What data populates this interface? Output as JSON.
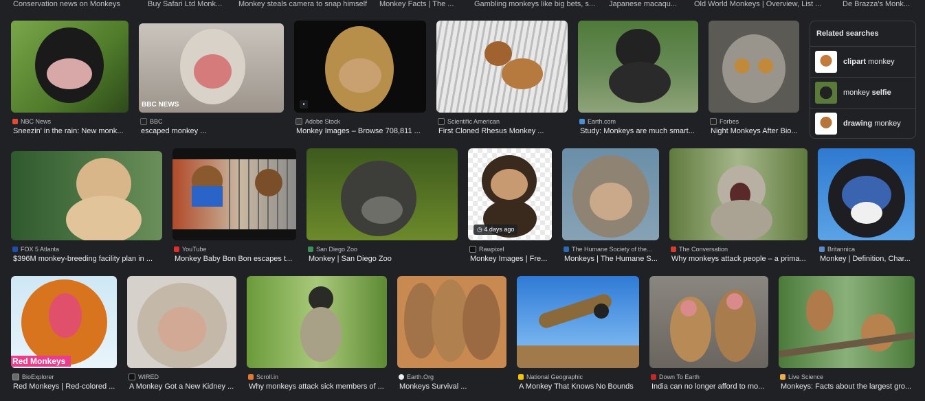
{
  "top_captions": [
    "Conservation news on Monkeys",
    "Buy Safari Ltd Monk...",
    "Monkey steals camera to snap himself",
    "Monkey Facts | The ...",
    "Gambling monkeys like big bets, s...",
    "Japanese macaqu...",
    "Old World Monkeys | Overview, List ...",
    "De Brazza's Monk..."
  ],
  "row1": [
    {
      "source": "NBC News",
      "caption": "Sneezin' in the rain: New monk...",
      "fav": "#e14b32"
    },
    {
      "source": "BBC",
      "caption": "escaped monkey ...",
      "fav": "#222222",
      "overlay": "BBC NEWS"
    },
    {
      "source": "Adobe Stock",
      "caption": "Monkey Images – Browse 708,811 ...",
      "fav": "#3a3a3a"
    },
    {
      "source": "Scientific American",
      "caption": "First Cloned Rhesus Monkey ...",
      "fav": "#1a1a1a"
    },
    {
      "source": "Earth.com",
      "caption": "Study: Monkeys are much smart...",
      "fav": "#4a90d9"
    },
    {
      "source": "Forbes",
      "caption": "Night Monkeys After Bio...",
      "fav": "#222222"
    }
  ],
  "related": {
    "title": "Related searches",
    "items": [
      {
        "bold": "clipart",
        "rest": " monkey",
        "bold_first": true
      },
      {
        "bold": "selfie",
        "rest": "monkey ",
        "bold_first": false
      },
      {
        "bold": "drawing",
        "rest": " monkey",
        "bold_first": true
      }
    ]
  },
  "row2": [
    {
      "source": "FOX 5 Atlanta",
      "caption": "$396M monkey-breeding facility plan in ...",
      "fav": "#1f4fa8"
    },
    {
      "source": "YouTube",
      "caption": "Monkey Baby Bon Bon escapes t...",
      "fav": "#e52d27"
    },
    {
      "source": "San Diego Zoo",
      "caption": "Monkey | San Diego Zoo",
      "fav": "#3e8e5a"
    },
    {
      "source": "Rawpixel",
      "caption": "Monkey Images | Fre...",
      "fav": "#111111",
      "badge": "4 days ago"
    },
    {
      "source": "The Humane Society of the...",
      "caption": "Monkeys | The Humane S...",
      "fav": "#2b6cb0"
    },
    {
      "source": "The Conversation",
      "caption": "Why monkeys attack people – a prima...",
      "fav": "#d33c2e"
    },
    {
      "source": "Britannica",
      "caption": "Monkey | Definition, Char...",
      "fav": "#5b8bc9"
    }
  ],
  "row3": [
    {
      "source": "BioExplorer",
      "caption": "Red Monkeys | Red-colored ...",
      "fav": "#6a6a6a",
      "overlay": "Red Monkeys"
    },
    {
      "source": "WIRED",
      "caption": "A Monkey Got a New Kidney ...",
      "fav": "#111111"
    },
    {
      "source": "Scroll.in",
      "caption": "Why monkeys attack sick members of ...",
      "fav": "#e8762c"
    },
    {
      "source": "Earth.Org",
      "caption": "Monkeys Survival ...",
      "fav": "#eeeeee"
    },
    {
      "source": "National Geographic",
      "caption": "A Monkey That Knows No Bounds",
      "fav": "#f5c400"
    },
    {
      "source": "Down To Earth",
      "caption": "India can no longer afford to mo...",
      "fav": "#c62828"
    },
    {
      "source": "Live Science",
      "caption": "Monkeys: Facts about the largest gro...",
      "fav": "#f0b040"
    }
  ]
}
